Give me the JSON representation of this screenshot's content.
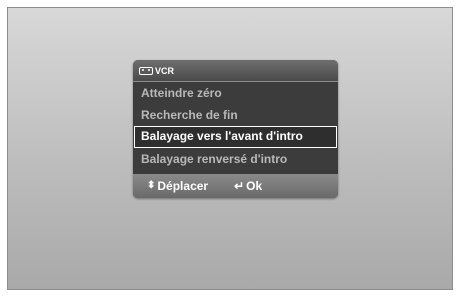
{
  "dialog": {
    "title": "VCR",
    "icon": "vcr-tape-icon"
  },
  "menu": {
    "items": [
      {
        "label": "Atteindre zéro",
        "selected": false
      },
      {
        "label": "Recherche de fin",
        "selected": false
      },
      {
        "label": "Balayage vers l'avant d'intro",
        "selected": true
      },
      {
        "label": "Balayage renversé d'intro",
        "selected": false
      }
    ]
  },
  "footer": {
    "move_icon": "up-down-arrows-icon",
    "move_label": "Déplacer",
    "ok_icon": "enter-icon",
    "ok_label": "Ok"
  }
}
